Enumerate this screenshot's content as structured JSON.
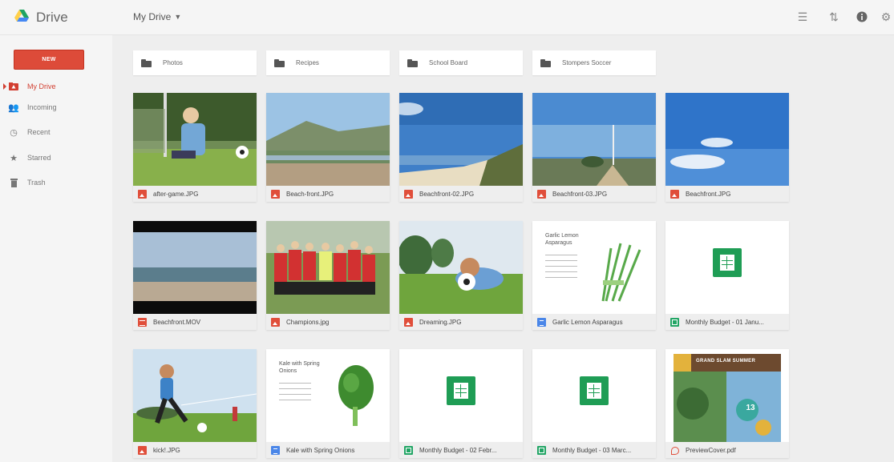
{
  "app": {
    "title": "Drive"
  },
  "header": {
    "breadcrumb": "My Drive"
  },
  "sidebar": {
    "new_label": "NEW",
    "items": [
      {
        "label": "My Drive",
        "icon": "drive-folder-icon",
        "active": true
      },
      {
        "label": "Incoming",
        "icon": "people-icon"
      },
      {
        "label": "Recent",
        "icon": "clock-icon"
      },
      {
        "label": "Starred",
        "icon": "star-icon"
      },
      {
        "label": "Trash",
        "icon": "trash-icon"
      }
    ]
  },
  "folders": [
    "Photos",
    "Recipes",
    "School Board",
    "Stompers Soccer"
  ],
  "files": [
    {
      "name": "after-game.JPG",
      "type": "image"
    },
    {
      "name": "Beach-front.JPG",
      "type": "image"
    },
    {
      "name": "Beachfront-02.JPG",
      "type": "image"
    },
    {
      "name": "Beachfront-03.JPG",
      "type": "image"
    },
    {
      "name": "Beachfront.JPG",
      "type": "image"
    },
    {
      "name": "Beachfront.MOV",
      "type": "video"
    },
    {
      "name": "Champions.jpg",
      "type": "image"
    },
    {
      "name": "Dreaming.JPG",
      "type": "image"
    },
    {
      "name": "Garlic Lemon Asparagus",
      "type": "doc",
      "preview_title": "Garlic Lemon Asparagus"
    },
    {
      "name": "Monthly Budget - 01 Janu...",
      "type": "sheet"
    },
    {
      "name": "kick!.JPG",
      "type": "image"
    },
    {
      "name": "Kale with Spring Onions",
      "type": "doc",
      "preview_title": "Kale with Spring Onions"
    },
    {
      "name": "Monthly Budget - 02 Febr...",
      "type": "sheet"
    },
    {
      "name": "Monthly Budget - 03 Marc...",
      "type": "sheet"
    },
    {
      "name": "PreviewCover.pdf",
      "type": "pdf",
      "preview_banner": "GRAND SLAM SUMMER",
      "preview_number": "13"
    }
  ],
  "colors": {
    "accent": "#dd4b39",
    "sheet": "#1f9d55",
    "doc": "#4a86e8"
  }
}
